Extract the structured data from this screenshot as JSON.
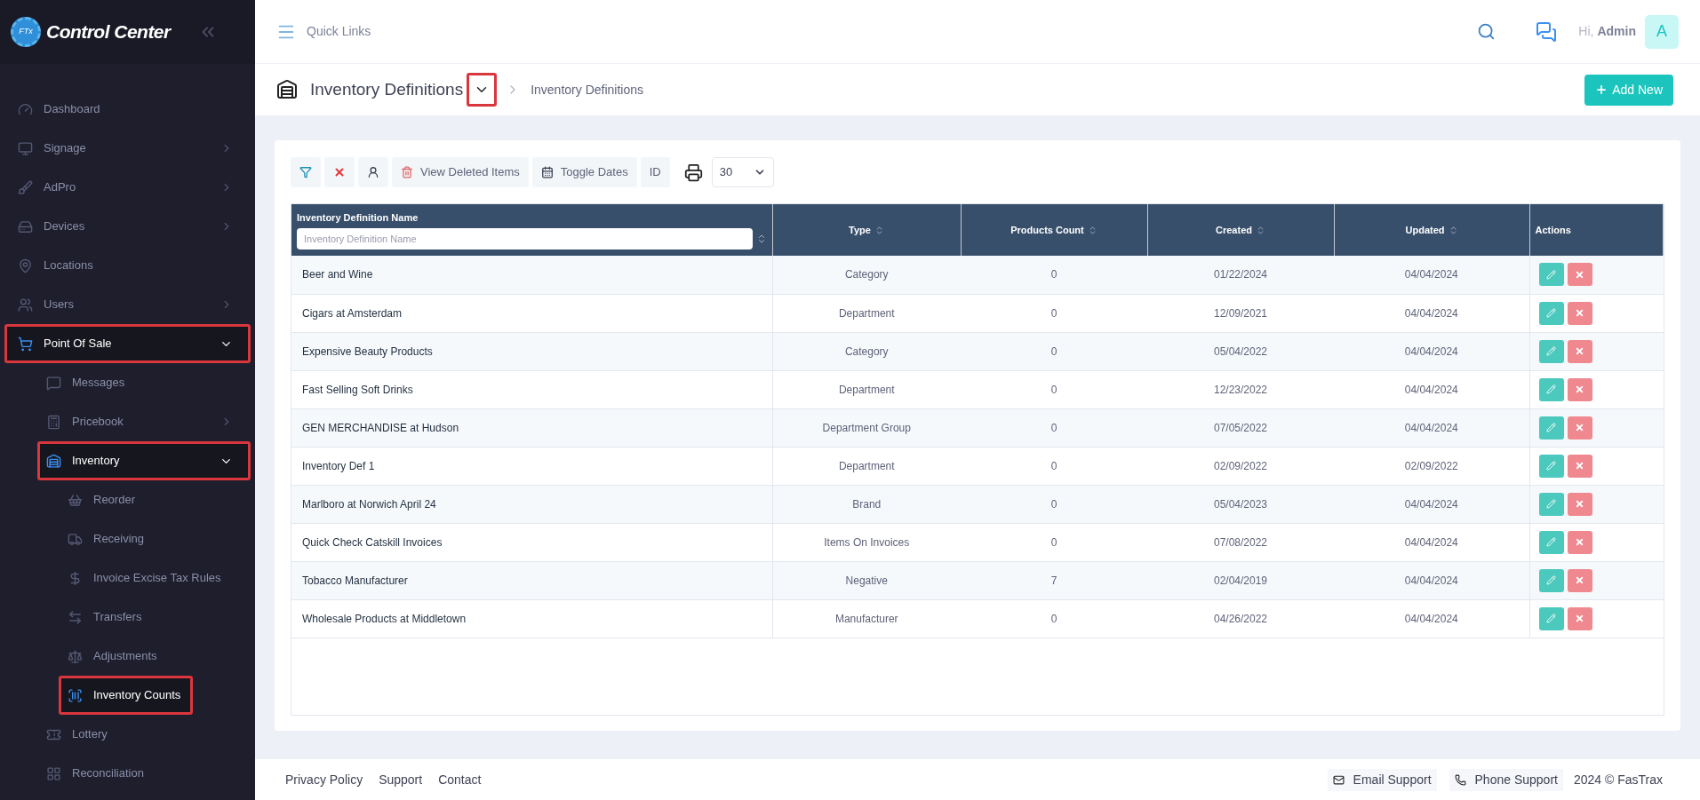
{
  "sidebar": {
    "logo_badge": "FTx",
    "logo_text": "Control Center",
    "items": [
      {
        "label": "Dashboard",
        "selected": false,
        "highlighted": false
      },
      {
        "label": "Signage",
        "expanded": false,
        "selected": false,
        "highlighted": false
      },
      {
        "label": "AdPro",
        "expanded": false,
        "selected": false,
        "highlighted": false
      },
      {
        "label": "Devices",
        "expanded": false,
        "selected": false,
        "highlighted": false
      },
      {
        "label": "Locations",
        "selected": false,
        "highlighted": false
      },
      {
        "label": "Users",
        "expanded": false,
        "selected": false,
        "highlighted": false
      },
      {
        "label": "Point Of Sale",
        "expanded": true,
        "selected": true,
        "highlighted": true,
        "children": [
          {
            "label": "Messages",
            "selected": false,
            "highlighted": false
          },
          {
            "label": "Pricebook",
            "expanded": false,
            "selected": false,
            "highlighted": false
          },
          {
            "label": "Inventory",
            "expanded": true,
            "selected": true,
            "highlighted": true,
            "children": [
              {
                "label": "Reorder",
                "selected": false,
                "highlighted": false
              },
              {
                "label": "Receiving",
                "selected": false,
                "highlighted": false
              },
              {
                "label": "Invoice Excise Tax Rules",
                "selected": false,
                "highlighted": false
              },
              {
                "label": "Transfers",
                "selected": false,
                "highlighted": false
              },
              {
                "label": "Adjustments",
                "selected": false,
                "highlighted": false
              },
              {
                "label": "Inventory Counts",
                "selected": true,
                "highlighted": true
              }
            ]
          },
          {
            "label": "Lottery",
            "selected": false,
            "highlighted": false
          },
          {
            "label": "Reconciliation",
            "selected": false,
            "highlighted": false
          }
        ]
      }
    ]
  },
  "topbar": {
    "quick_links": "Quick Links",
    "greeting": "Hi,",
    "user": "Admin",
    "avatar": "A"
  },
  "page_header": {
    "title": "Inventory Definitions",
    "dropdown_highlighted": true,
    "breadcrumb": "Inventory Definitions",
    "add_button": "Add New"
  },
  "toolbar": {
    "buttons": [
      {
        "kind": "filter"
      },
      {
        "kind": "clear"
      },
      {
        "kind": "user"
      },
      {
        "kind": "deleted",
        "label": "View Deleted Items"
      },
      {
        "kind": "dates",
        "label": "Toggle Dates"
      },
      {
        "kind": "text",
        "label": "ID"
      }
    ],
    "page_size": "30"
  },
  "table": {
    "columns": [
      {
        "label": "Inventory Definition Name",
        "placeholder": "Inventory Definition Name",
        "sortable": true
      },
      {
        "label": "Type",
        "sortable": true
      },
      {
        "label": "Products Count",
        "sortable": true
      },
      {
        "label": "Created",
        "sortable": true
      },
      {
        "label": "Updated",
        "sortable": true
      },
      {
        "label": "Actions",
        "sortable": false
      }
    ],
    "rows": [
      [
        "Beer and Wine",
        "Category",
        "0",
        "01/22/2024",
        "04/04/2024"
      ],
      [
        "Cigars at Amsterdam",
        "Department",
        "0",
        "12/09/2021",
        "04/04/2024"
      ],
      [
        "Expensive Beauty Products",
        "Category",
        "0",
        "05/04/2022",
        "04/04/2024"
      ],
      [
        "Fast Selling Soft Drinks",
        "Department",
        "0",
        "12/23/2022",
        "04/04/2024"
      ],
      [
        "GEN MERCHANDISE at Hudson",
        "Department Group",
        "0",
        "07/05/2022",
        "04/04/2024"
      ],
      [
        "Inventory Def 1",
        "Department",
        "0",
        "02/09/2022",
        "02/09/2022"
      ],
      [
        "Marlboro at Norwich April 24",
        "Brand",
        "0",
        "05/04/2023",
        "04/04/2024"
      ],
      [
        "Quick Check Catskill Invoices",
        "Items On Invoices",
        "0",
        "07/08/2022",
        "04/04/2024"
      ],
      [
        "Tobacco Manufacturer",
        "Negative",
        "7",
        "02/04/2019",
        "04/04/2024"
      ],
      [
        "Wholesale Products at Middletown",
        "Manufacturer",
        "0",
        "04/26/2022",
        "04/04/2024"
      ]
    ]
  },
  "footer": {
    "links": [
      "Privacy Policy",
      "Support",
      "Contact"
    ],
    "email": "Email Support",
    "phone": "Phone Support",
    "copyright": "2024 © FasTrax"
  }
}
